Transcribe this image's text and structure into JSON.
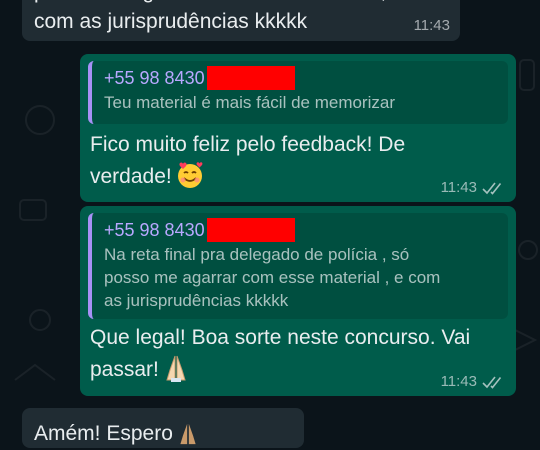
{
  "messages": {
    "top_incoming": {
      "text": "posso me agarrar com esse material , e\ncom as jurisprudências kkkkk",
      "time": "11:43"
    },
    "reply1": {
      "quote_name": "+55 98 8430",
      "quote_text": "Teu material é mais fácil de memorizar",
      "text": "Fico muito feliz pelo feedback! De\nverdade!",
      "emoji": "smiling-face-with-hearts",
      "time": "11:43",
      "status": "double-check"
    },
    "reply2": {
      "quote_name": "+55 98 8430",
      "quote_text": "Na reta final pra delegado de polícia , só\nposso me agarrar com esse material , e com\nas jurisprudências kkkkk",
      "text": "Que legal! Boa sorte neste concurso. Vai\npassar!",
      "emoji": "folded-hands",
      "time": "11:43",
      "status": "double-check"
    },
    "bottom_incoming": {
      "text": "Amém! Espero"
    }
  },
  "colors": {
    "background": "#0b141a",
    "incoming_bubble": "#202c33",
    "outgoing_bubble": "#005c4b",
    "quote_accent": "#a791f6",
    "redaction": "#ff0000"
  }
}
